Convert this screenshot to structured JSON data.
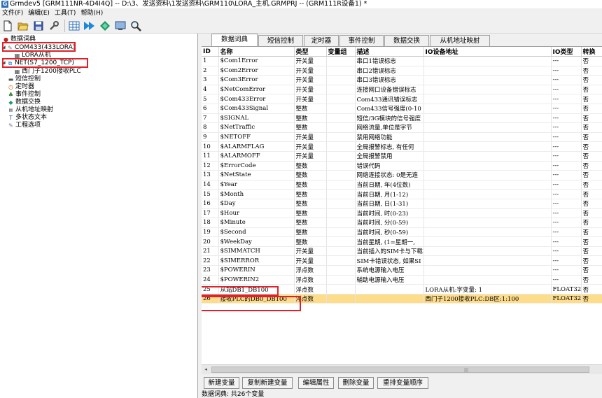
{
  "window": {
    "title": "Grmdev5 [GRM111NR-4D4I4Q] -- D:\\3、发送资料\\1发送资料\\GRM110\\LORA_主机.GRMPRJ -- (GRM111R设备1) *"
  },
  "menu": [
    "文件(F)",
    "编辑(E)",
    "工具(T)",
    "帮助(H)"
  ],
  "tree": {
    "data_dictionary": "数据词典",
    "com433": "COM433(433LORA)",
    "lora_slave": "LORA从机",
    "net": "NET(S7_1200_TCP)",
    "siemens_plc": "西门子1200接收PLC",
    "sms_control": "短信控制",
    "timer": "定时器",
    "event_control": "事件控制",
    "data_exchange": "数据交换",
    "slave_address_map": "从机地址映射",
    "multi_state_text": "多状态文本",
    "project_options": "工程选项"
  },
  "tabs": [
    "数据词典",
    "短信控制",
    "定时器",
    "事件控制",
    "数据交换",
    "从机地址映射"
  ],
  "table": {
    "headers": [
      "ID",
      "名称",
      "类型",
      "变量组",
      "描述",
      "IO设备地址",
      "IO类型",
      "转换"
    ],
    "rows": [
      [
        "1",
        "$Com1Error",
        "开关量",
        "",
        "串口1错误标志",
        "",
        "---",
        "否"
      ],
      [
        "2",
        "$Com2Error",
        "开关量",
        "",
        "串口2错误标志",
        "",
        "---",
        "否"
      ],
      [
        "3",
        "$Com3Error",
        "开关量",
        "",
        "串口3错误标志",
        "",
        "---",
        "否"
      ],
      [
        "4",
        "$NetComError",
        "开关量",
        "",
        "连接网口设备错误标志",
        "",
        "---",
        "否"
      ],
      [
        "5",
        "$Com433Error",
        "开关量",
        "",
        "Com433通讯错误标志",
        "",
        "---",
        "否"
      ],
      [
        "6",
        "$Com433Signal",
        "整数",
        "",
        "Com433信号强度(0-10",
        "",
        "---",
        "否"
      ],
      [
        "7",
        "$SIGNAL",
        "整数",
        "",
        "短信/3G模块的信号强度",
        "",
        "---",
        "否"
      ],
      [
        "8",
        "$NetTraffic",
        "整数",
        "",
        "网络流量,单位是字节",
        "",
        "---",
        "否"
      ],
      [
        "9",
        "$NETOFF",
        "开关量",
        "",
        "禁用网络功能",
        "",
        "---",
        "否"
      ],
      [
        "10",
        "$ALARMFLAG",
        "开关量",
        "",
        "全局报警标志, 有任何",
        "",
        "---",
        "否"
      ],
      [
        "11",
        "$ALARMOFF",
        "开关量",
        "",
        "全局报警禁用",
        "",
        "---",
        "否"
      ],
      [
        "12",
        "$ErrorCode",
        "整数",
        "",
        "错误代码",
        "",
        "---",
        "否"
      ],
      [
        "13",
        "$NetState",
        "整数",
        "",
        "网络连接状态: 0是无连",
        "",
        "---",
        "否"
      ],
      [
        "14",
        "$Year",
        "整数",
        "",
        "当前日期, 年(4位数)",
        "",
        "---",
        "否"
      ],
      [
        "15",
        "$Month",
        "整数",
        "",
        "当前日期, 月(1-12)",
        "",
        "---",
        "否"
      ],
      [
        "16",
        "$Day",
        "整数",
        "",
        "当前日期, 日(1-31)",
        "",
        "---",
        "否"
      ],
      [
        "17",
        "$Hour",
        "整数",
        "",
        "当前时间, 时(0-23)",
        "",
        "---",
        "否"
      ],
      [
        "18",
        "$Minute",
        "整数",
        "",
        "当前时间, 分(0-59)",
        "",
        "---",
        "否"
      ],
      [
        "19",
        "$Second",
        "整数",
        "",
        "当前时间, 秒(0-59)",
        "",
        "---",
        "否"
      ],
      [
        "20",
        "$WeekDay",
        "整数",
        "",
        "当前星期, (1=星期一,",
        "",
        "---",
        "否"
      ],
      [
        "21",
        "$SIMMATCH",
        "开关量",
        "",
        "当前插入的SIM卡与下载",
        "",
        "---",
        "否"
      ],
      [
        "22",
        "$SIMERROR",
        "开关量",
        "",
        "SIM卡错误状态, 如果SI",
        "",
        "---",
        "否"
      ],
      [
        "23",
        "$POWERIN",
        "浮点数",
        "",
        "系统电源输入电压",
        "",
        "---",
        "否"
      ],
      [
        "24",
        "$POWERIN2",
        "浮点数",
        "",
        "辅助电源输入电压",
        "",
        "---",
        "否"
      ],
      [
        "25",
        "从站DB1_DB100",
        "浮点数",
        "",
        "",
        "LORA从机:字变量:    1",
        "FLOAT32",
        "否"
      ],
      [
        "26",
        "接收PLC的DB0_DB100",
        "浮点数",
        "",
        "",
        "西门子1200接收PLC:DB区:1:100",
        "FLOAT32",
        "否"
      ]
    ],
    "selected_row": 26
  },
  "buttons": {
    "new_var": "新建变量",
    "copy_new_var": "复制新建变量",
    "edit_props": "编辑属性",
    "delete_var": "删除变量",
    "reorder": "重排变量顺序"
  },
  "status": "数据词典: 共26个变量",
  "scroll_grip": "|||",
  "colors": {
    "highlight_row": "#fddc8a",
    "annotation_box": "#e0212a"
  },
  "icons": [
    "new-file-icon",
    "open-folder-icon",
    "save-icon",
    "tools-icon",
    "table-icon",
    "download-icon",
    "connect-icon",
    "monitor-icon",
    "search-icon"
  ]
}
